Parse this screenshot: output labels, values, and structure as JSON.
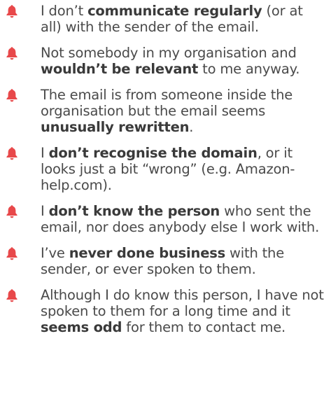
{
  "bell_color": "#e8484a",
  "icon": "bell-icon",
  "items": [
    {
      "before": "I don’t ",
      "bold": "communicate regularly",
      "after": " (or at all) with the sender of the email."
    },
    {
      "before": "Not somebody in my organisation and ",
      "bold": "wouldn’t be relevant",
      "after": " to me anyway."
    },
    {
      "before": "The email is from someone inside the organisation but the email seems ",
      "bold": "unusually rewritten",
      "after": "."
    },
    {
      "before": "I ",
      "bold": "don’t recognise the domain",
      "after": ", or it looks just a bit “wrong” (e.g. Amazon-help.com)."
    },
    {
      "before": "I ",
      "bold": "don’t know the person",
      "after": " who sent the email, nor does anybody else I work with."
    },
    {
      "before": "I’ve ",
      "bold": "never done business",
      "after": " with the sender, or ever spoken to them."
    },
    {
      "before": "Although I do know this person, I have not spoken to them for a long time and it ",
      "bold": "seems odd",
      "after": " for them to contact me."
    }
  ]
}
